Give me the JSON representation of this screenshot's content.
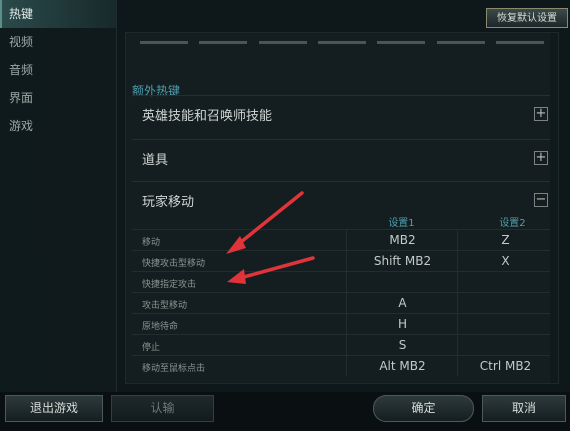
{
  "sidebar": {
    "items": [
      {
        "label": "热键",
        "active": true
      },
      {
        "label": "视频",
        "active": false
      },
      {
        "label": "音频",
        "active": false
      },
      {
        "label": "界面",
        "active": false
      },
      {
        "label": "游戏",
        "active": false
      }
    ]
  },
  "header": {
    "restore_label": "恢复默认设置"
  },
  "section": {
    "title": "额外热键"
  },
  "groups": [
    {
      "label": "英雄技能和召唤师技能",
      "toggle": "+"
    },
    {
      "label": "道具",
      "toggle": "+"
    },
    {
      "label": "玩家移动",
      "toggle": "−"
    }
  ],
  "table": {
    "headers": [
      "设置1",
      "设置2"
    ],
    "rows": [
      {
        "label": "移动",
        "s1": "MB2",
        "s2": "Z"
      },
      {
        "label": "快捷攻击型移动",
        "s1": "Shift MB2",
        "s2": "X"
      },
      {
        "label": "快捷指定攻击",
        "s1": "",
        "s2": ""
      },
      {
        "label": "攻击型移动",
        "s1": "A",
        "s2": ""
      },
      {
        "label": "原地待命",
        "s1": "H",
        "s2": ""
      },
      {
        "label": "停止",
        "s1": "S",
        "s2": ""
      },
      {
        "label": "移动至鼠标点击",
        "s1": "Alt MB2",
        "s2": "Ctrl MB2"
      }
    ]
  },
  "footer": {
    "quit_label": "退出游戏",
    "surrender_label": "认输",
    "ok_label": "确定",
    "cancel_label": "取消"
  },
  "colors": {
    "accent": "#4f9dad",
    "arrow": "#e0343a"
  },
  "icons": {
    "expand": "plus-icon",
    "collapse": "minus-icon"
  }
}
